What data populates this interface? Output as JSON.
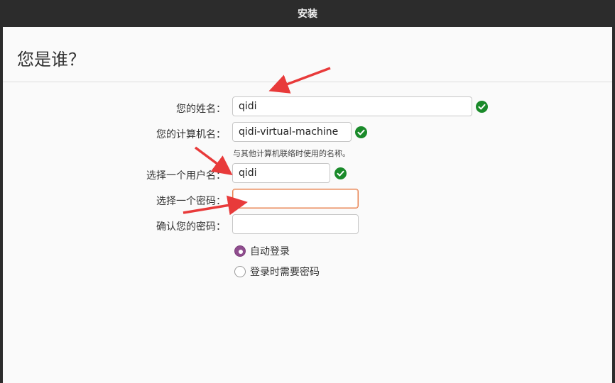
{
  "window": {
    "title": "安装"
  },
  "page": {
    "heading": "您是谁？"
  },
  "form": {
    "name_label": "您的姓名：",
    "name_value": "qidi",
    "computer_label": "您的计算机名：",
    "computer_value": "qidi-virtual-machine",
    "computer_hint": "与其他计算机联络时使用的名称。",
    "username_label": "选择一个用户名：",
    "username_value": "qidi",
    "password_label": "选择一个密码：",
    "password_value": "",
    "confirm_label": "确认您的密码：",
    "confirm_value": ""
  },
  "login_options": [
    {
      "label": "自动登录",
      "selected": true
    },
    {
      "label": "登录时需要密码",
      "selected": false
    }
  ],
  "icons": {
    "valid": "check-circle-icon"
  },
  "colors": {
    "valid": "#1a8a2a",
    "radio_selected": "#8f4d8e",
    "focus_border": "#e9804f",
    "annotation_arrow": "#e83a3a"
  }
}
